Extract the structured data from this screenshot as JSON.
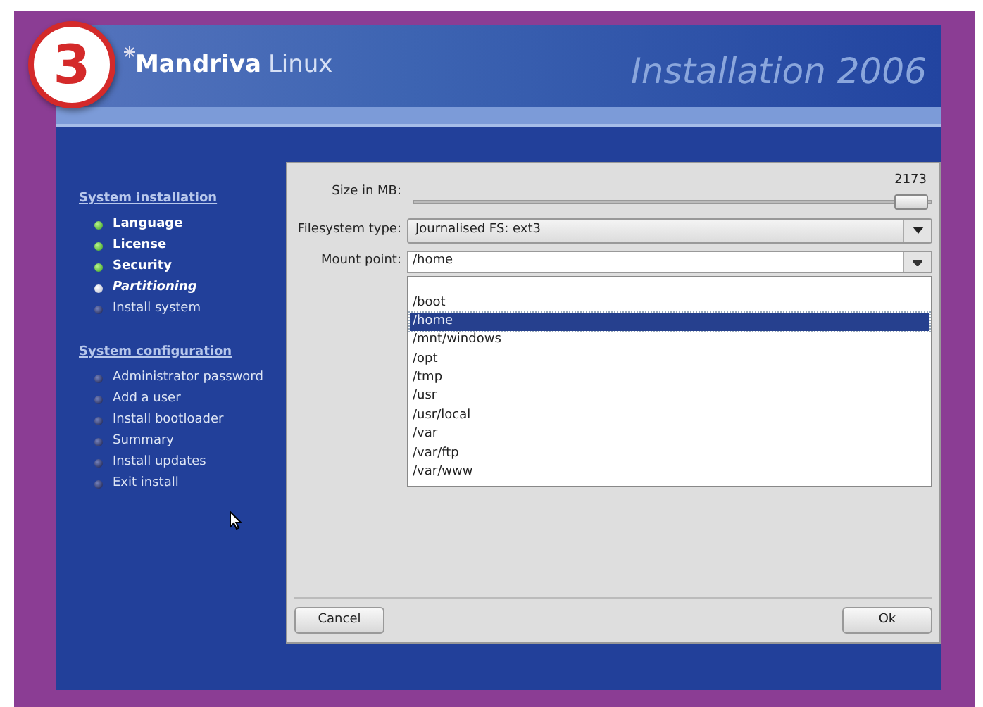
{
  "badge": "3",
  "header": {
    "brand": "Mandriva",
    "brand_suffix": "Linux",
    "title": "Installation 2006"
  },
  "sidebar": {
    "sections": [
      {
        "title": "System installation",
        "items": [
          {
            "label": "Language",
            "kind": "done"
          },
          {
            "label": "License",
            "kind": "done"
          },
          {
            "label": "Security",
            "kind": "done"
          },
          {
            "label": "Partitioning",
            "kind": "current"
          },
          {
            "label": "Install system",
            "kind": "pending"
          }
        ]
      },
      {
        "title": "System configuration",
        "items": [
          {
            "label": "Administrator password",
            "kind": "pending"
          },
          {
            "label": "Add a user",
            "kind": "pending"
          },
          {
            "label": "Install bootloader",
            "kind": "pending"
          },
          {
            "label": "Summary",
            "kind": "pending"
          },
          {
            "label": "Install updates",
            "kind": "pending"
          },
          {
            "label": "Exit install",
            "kind": "pending"
          }
        ]
      }
    ]
  },
  "dialog": {
    "size": {
      "label": "Size in MB:",
      "reading": "2173",
      "level": 0.99
    },
    "filesystem": {
      "label": "Filesystem type:",
      "value": "Journalised FS: ext3"
    },
    "mount": {
      "label": "Mount point:",
      "value": "/home",
      "expanded": true,
      "options": [
        {
          "label": "/boot",
          "selected": false
        },
        {
          "label": "/home",
          "selected": true
        },
        {
          "label": "/mnt/windows",
          "selected": false
        },
        {
          "label": "/opt",
          "selected": false
        },
        {
          "label": "/tmp",
          "selected": false
        },
        {
          "label": "/usr",
          "selected": false
        },
        {
          "label": "/usr/local",
          "selected": false
        },
        {
          "label": "/var",
          "selected": false
        },
        {
          "label": "/var/ftp",
          "selected": false
        },
        {
          "label": "/var/www",
          "selected": false
        }
      ]
    },
    "buttons": {
      "cancel": "Cancel",
      "ok": "Ok"
    }
  }
}
